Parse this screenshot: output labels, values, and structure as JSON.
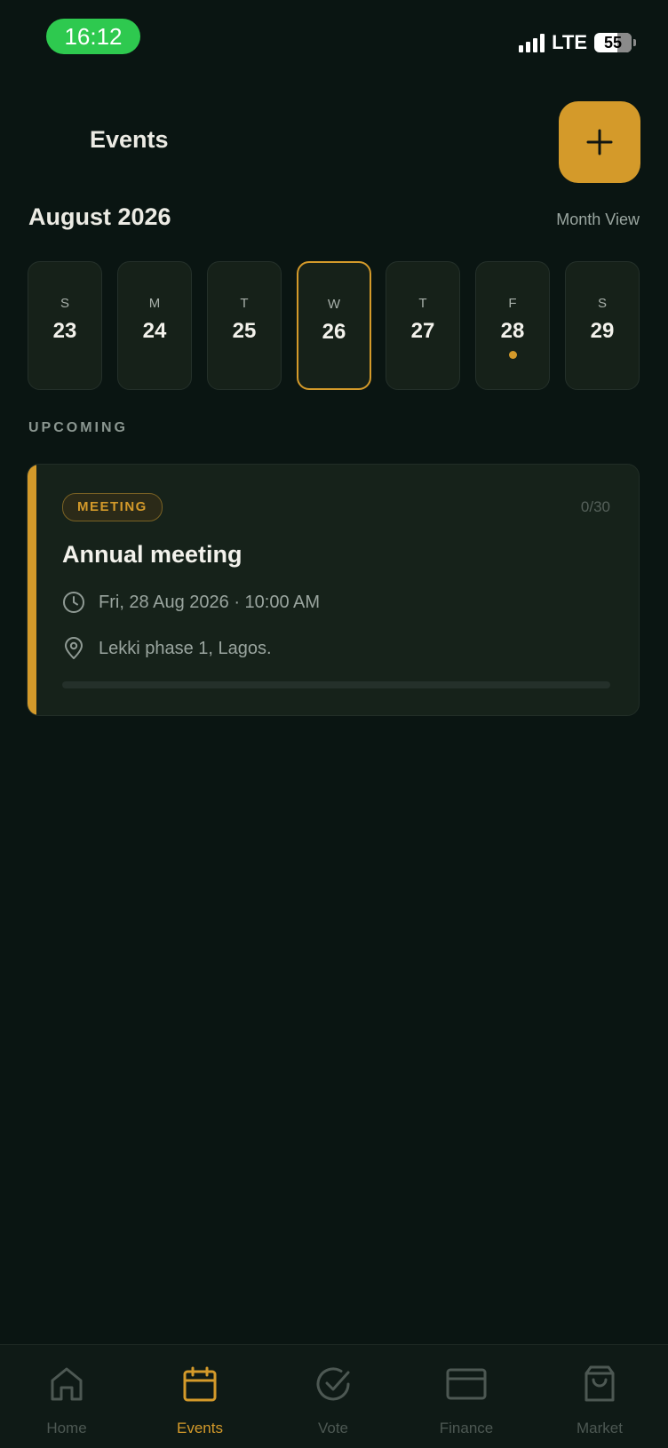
{
  "status": {
    "time": "16:12",
    "network": "LTE",
    "battery": "55"
  },
  "header": {
    "title": "Events"
  },
  "calendar": {
    "month": "August 2026",
    "view_toggle": "Month View",
    "days": [
      {
        "letter": "S",
        "num": "23"
      },
      {
        "letter": "M",
        "num": "24"
      },
      {
        "letter": "T",
        "num": "25"
      },
      {
        "letter": "W",
        "num": "26",
        "selected": true
      },
      {
        "letter": "T",
        "num": "27"
      },
      {
        "letter": "F",
        "num": "28",
        "has_event": true
      },
      {
        "letter": "S",
        "num": "29"
      }
    ]
  },
  "upcoming": {
    "label": "UPCOMING",
    "events": [
      {
        "tag": "MEETING",
        "count": "0/30",
        "title": "Annual meeting",
        "datetime": "Fri, 28 Aug 2026 · 10:00 AM",
        "location": "Lekki phase 1, Lagos.",
        "progress": 0
      }
    ]
  },
  "tabs": [
    {
      "label": "Home",
      "icon": "home-icon"
    },
    {
      "label": "Events",
      "icon": "calendar-icon",
      "active": true
    },
    {
      "label": "Vote",
      "icon": "check-circle-icon"
    },
    {
      "label": "Finance",
      "icon": "card-icon"
    },
    {
      "label": "Market",
      "icon": "bag-icon"
    }
  ],
  "colors": {
    "accent": "#d49a2a",
    "background": "#0a1512",
    "card": "#16221a"
  }
}
